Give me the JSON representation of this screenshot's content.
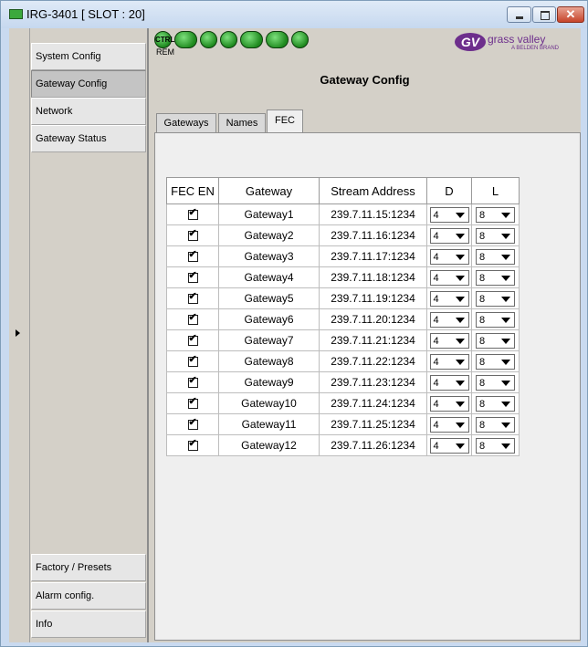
{
  "window": {
    "title": "IRG-3401 [ SLOT : 20]"
  },
  "nav": {
    "top_items": [
      "System Config",
      "Gateway Config",
      "Network",
      "Gateway Status"
    ],
    "bottom_items": [
      "Factory / Presets",
      "Alarm config.",
      "Info"
    ],
    "active": "Gateway Config"
  },
  "toolbar": {
    "ctrl_label": "CTRL",
    "rem_label": "REM"
  },
  "logo": {
    "mark": "GV",
    "text": "grass valley",
    "sub": "A BELDEN BRAND"
  },
  "panel": {
    "title": "Gateway Config",
    "tabs": [
      "Gateways",
      "Names",
      "FEC"
    ],
    "active_tab": "FEC"
  },
  "table": {
    "headers": [
      "FEC EN",
      "Gateway",
      "Stream Address",
      "D",
      "L"
    ],
    "rows": [
      {
        "enabled": true,
        "gateway": "Gateway1",
        "address": "239.7.11.15:1234",
        "d": "4",
        "l": "8"
      },
      {
        "enabled": true,
        "gateway": "Gateway2",
        "address": "239.7.11.16:1234",
        "d": "4",
        "l": "8"
      },
      {
        "enabled": true,
        "gateway": "Gateway3",
        "address": "239.7.11.17:1234",
        "d": "4",
        "l": "8"
      },
      {
        "enabled": true,
        "gateway": "Gateway4",
        "address": "239.7.11.18:1234",
        "d": "4",
        "l": "8"
      },
      {
        "enabled": true,
        "gateway": "Gateway5",
        "address": "239.7.11.19:1234",
        "d": "4",
        "l": "8"
      },
      {
        "enabled": true,
        "gateway": "Gateway6",
        "address": "239.7.11.20:1234",
        "d": "4",
        "l": "8"
      },
      {
        "enabled": true,
        "gateway": "Gateway7",
        "address": "239.7.11.21:1234",
        "d": "4",
        "l": "8"
      },
      {
        "enabled": true,
        "gateway": "Gateway8",
        "address": "239.7.11.22:1234",
        "d": "4",
        "l": "8"
      },
      {
        "enabled": true,
        "gateway": "Gateway9",
        "address": "239.7.11.23:1234",
        "d": "4",
        "l": "8"
      },
      {
        "enabled": true,
        "gateway": "Gateway10",
        "address": "239.7.11.24:1234",
        "d": "4",
        "l": "8"
      },
      {
        "enabled": true,
        "gateway": "Gateway11",
        "address": "239.7.11.25:1234",
        "d": "4",
        "l": "8"
      },
      {
        "enabled": true,
        "gateway": "Gateway12",
        "address": "239.7.11.26:1234",
        "d": "4",
        "l": "8"
      }
    ]
  },
  "colors": {
    "accent_logo": "#6d2e8c",
    "status_green": "#2ea02e",
    "panel_bg": "#d4d0c8"
  }
}
